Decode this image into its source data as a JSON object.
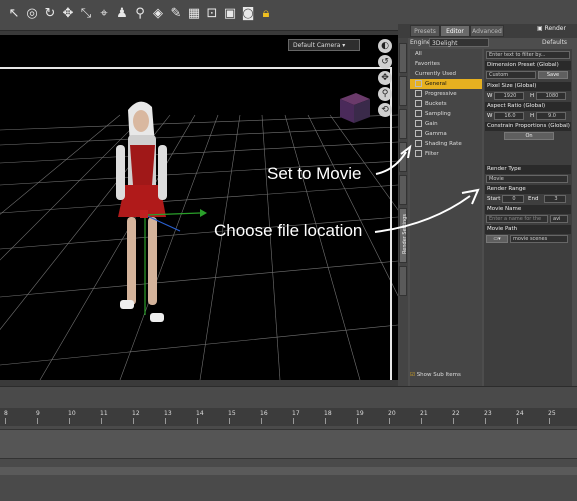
{
  "viewport": {
    "camera_label": "Default Camera"
  },
  "panel": {
    "tabs": [
      "Presets",
      "Editor",
      "Advanced"
    ],
    "render_label": "Render",
    "engine_label": "Engine",
    "engine_value": "3Delight",
    "defaults_label": "Defaults",
    "filter_placeholder": "Enter text to filter by...",
    "side_tabs": [
      "Render Settings"
    ],
    "categories": [
      {
        "label": "All",
        "icon": false,
        "selected": false
      },
      {
        "label": "Favorites",
        "icon": false,
        "selected": false
      },
      {
        "label": "Currently Used",
        "icon": false,
        "selected": false
      },
      {
        "label": "General",
        "icon": true,
        "selected": true
      },
      {
        "label": "Progressive",
        "icon": true,
        "selected": false
      },
      {
        "label": "Buckets",
        "icon": true,
        "selected": false
      },
      {
        "label": "Sampling",
        "icon": true,
        "selected": false
      },
      {
        "label": "Gain",
        "icon": true,
        "selected": false
      },
      {
        "label": "Gamma",
        "icon": true,
        "selected": false
      },
      {
        "label": "Shading Rate",
        "icon": true,
        "selected": false
      },
      {
        "label": "Filter",
        "icon": true,
        "selected": false
      }
    ],
    "show_sub_items": "Show Sub Items",
    "props": {
      "dimension_preset_label": "Dimension Preset (Global)",
      "dimension_preset_value": "Custom",
      "save_label": "Save",
      "pixel_size_label": "Pixel Size (Global)",
      "w_label": "W",
      "w_value": "1920",
      "h_label": "H",
      "h_value": "1080",
      "aspect_label": "Aspect Ratio (Global)",
      "aspect_w": "16.0",
      "aspect_h": "9.0",
      "constrain_label": "Constrain Proportions (Global)",
      "constrain_value": "On",
      "render_type_label": "Render Type",
      "render_type_value": "Movie",
      "render_range_label": "Render Range",
      "start_label": "Start",
      "start_value": "0",
      "end_label": "End",
      "end_value": "3",
      "movie_name_label": "Movie Name",
      "movie_name_placeholder": "Enter a name for the r...",
      "movie_ext": "avi",
      "movie_path_label": "Movie Path",
      "movie_path_value": "movie scenes"
    }
  },
  "annotations": {
    "set_movie": "Set to Movie",
    "choose_location": "Choose file location"
  },
  "timeline": {
    "ticks": [
      "8",
      "9",
      "10",
      "11",
      "12",
      "13",
      "14",
      "15",
      "16",
      "17",
      "18",
      "19",
      "20",
      "21",
      "22",
      "23",
      "24",
      "25"
    ]
  }
}
